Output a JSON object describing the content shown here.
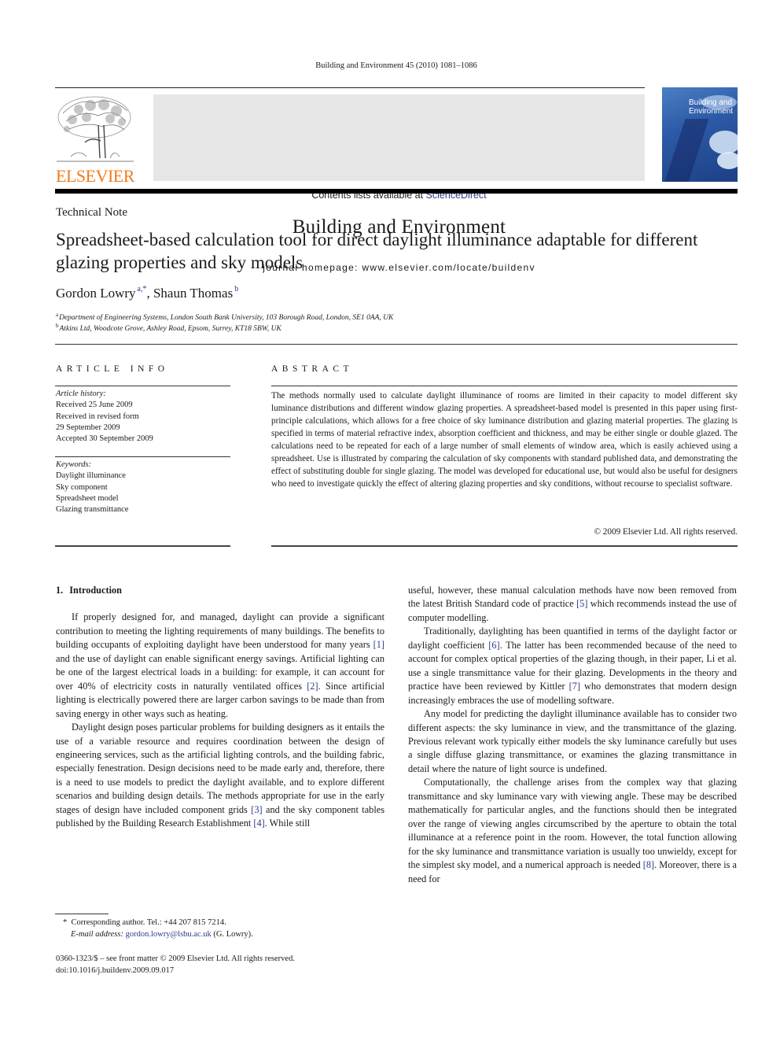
{
  "running_head": "Building and Environment 45 (2010) 1081–1086",
  "masthead": {
    "contents_prefix": "Contents lists available at ",
    "contents_link": "ScienceDirect",
    "journal_title": "Building and Environment",
    "homepage": "journal homepage: www.elsevier.com/locate/buildenv",
    "publisher_logo": "ELSEVIER",
    "cover_title_line1": "Building and",
    "cover_title_line2": "Environment"
  },
  "colors": {
    "link": "#2b3a8c",
    "elsevier_orange": "#f07c1c",
    "masthead_bg": "#e6e6e6"
  },
  "article": {
    "type": "Technical Note",
    "title": "Spreadsheet-based calculation tool for direct daylight illuminance adaptable for different glazing properties and sky models",
    "authors": [
      {
        "name": "Gordon Lowry",
        "marks": "a,*"
      },
      {
        "name": "Shaun Thomas",
        "marks": "b"
      }
    ],
    "author_separator": ", ",
    "affiliations": [
      {
        "mark": "a",
        "text": "Department of Engineering Systems, London South Bank University, 103 Borough Road, London, SE1 0AA, UK"
      },
      {
        "mark": "b",
        "text": "Atkins Ltd, Woodcote Grove, Ashley Road, Epsom, Surrey, KT18 5BW, UK"
      }
    ]
  },
  "article_info": {
    "heading": "ARTICLE INFO",
    "history_label": "Article history:",
    "history": [
      "Received 25 June 2009",
      "Received in revised form",
      "29 September 2009",
      "Accepted 30 September 2009"
    ],
    "keywords_label": "Keywords:",
    "keywords": [
      "Daylight illuminance",
      "Sky component",
      "Spreadsheet model",
      "Glazing transmittance"
    ]
  },
  "abstract": {
    "heading": "ABSTRACT",
    "text": "The methods normally used to calculate daylight illuminance of rooms are limited in their capacity to model different sky luminance distributions and different window glazing properties. A spreadsheet-based model is presented in this paper using first-principle calculations, which allows for a free choice of sky luminance distribution and glazing material properties. The glazing is specified in terms of material refractive index, absorption coefficient and thickness, and may be either single or double glazed. The calculations need to be repeated for each of a large number of small elements of window area, which is easily achieved using a spreadsheet. Use is illustrated by comparing the calculation of sky components with standard published data, and demonstrating the effect of substituting double for single glazing. The model was developed for educational use, but would also be useful for designers who need to investigate quickly the effect of altering glazing properties and sky conditions, without recourse to specialist software.",
    "copyright": "© 2009 Elsevier Ltd. All rights reserved."
  },
  "body": {
    "section_number": "1.",
    "section_title": "Introduction",
    "left_paragraphs": [
      [
        {
          "t": "If properly designed for, and managed, daylight can provide a significant contribution to meeting the lighting requirements of many buildings. The benefits to building occupants of exploiting daylight have been understood for many years "
        },
        {
          "ref": "[1]"
        },
        {
          "t": " and the use of daylight can enable significant energy savings. Artificial lighting can be one of the largest electrical loads in a building: for example, it can account for over 40% of electricity costs in naturally ventilated offices "
        },
        {
          "ref": "[2]"
        },
        {
          "t": ". Since artificial lighting is electrically powered there are larger carbon savings to be made than from saving energy in other ways such as heating."
        }
      ],
      [
        {
          "t": "Daylight design poses particular problems for building designers as it entails the use of a variable resource and requires coordination between the design of engineering services, such as the artificial lighting controls, and the building fabric, especially fenestration. Design decisions need to be made early and, therefore, there is a need to use models to predict the daylight available, and to explore different scenarios and building design details. The methods appropriate for use in the early stages of design have included component grids "
        },
        {
          "ref": "[3]"
        },
        {
          "t": " and the sky component tables published by the Building Research Establishment "
        },
        {
          "ref": "[4]"
        },
        {
          "t": ". While still"
        }
      ]
    ],
    "right_paragraphs": [
      [
        {
          "t": "useful, however, these manual calculation methods have now been removed from the latest British Standard code of practice "
        },
        {
          "ref": "[5]"
        },
        {
          "t": " which recommends instead the use of computer modelling."
        }
      ],
      [
        {
          "t": "Traditionally, daylighting has been quantified in terms of the daylight factor or daylight coefficient "
        },
        {
          "ref": "[6]"
        },
        {
          "t": ". The latter has been recommended because of the need to account for complex optical properties of the glazing though, in their paper, Li et al. use a single transmittance value for their glazing. Developments in the theory and practice have been reviewed by Kittler "
        },
        {
          "ref": "[7]"
        },
        {
          "t": " who demonstrates that modern design increasingly embraces the use of modelling software."
        }
      ],
      [
        {
          "t": "Any model for predicting the daylight illuminance available has to consider two different aspects: the sky luminance in view, and the transmittance of the glazing. Previous relevant work typically either models the sky luminance carefully but uses a single diffuse glazing transmittance, or examines the glazing transmittance in detail where the nature of light source is undefined."
        }
      ],
      [
        {
          "t": "Computationally, the challenge arises from the complex way that glazing transmittance and sky luminance vary with viewing angle. These may be described mathematically for particular angles, and the functions should then be integrated over the range of viewing angles circumscribed by the aperture to obtain the total illuminance at a reference point in the room. However, the total function allowing for the sky luminance and transmittance variation is usually too unwieldy, except for the simplest sky model, and a numerical approach is needed "
        },
        {
          "ref": "[8]"
        },
        {
          "t": ". Moreover, there is a need for"
        }
      ]
    ]
  },
  "footnote": {
    "mark": "*",
    "corresponding": "Corresponding author. Tel.: +44 207 815 7214.",
    "email_label": "E-mail address:",
    "email": "gordon.lowry@lsbu.ac.uk",
    "email_suffix": " (G. Lowry)."
  },
  "front_matter": {
    "issn_line": "0360-1323/$ – see front matter © 2009 Elsevier Ltd. All rights reserved.",
    "doi": "doi:10.1016/j.buildenv.2009.09.017"
  }
}
